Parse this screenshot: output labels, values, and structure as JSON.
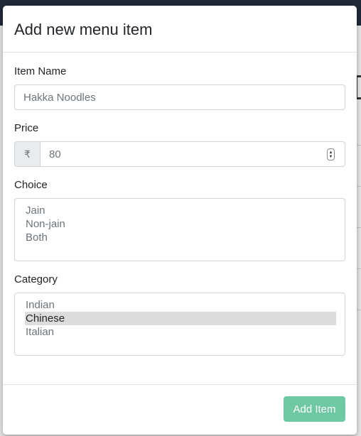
{
  "modal": {
    "title": "Add new menu item",
    "item_name": {
      "label": "Item Name",
      "placeholder": "Hakka Noodles"
    },
    "price": {
      "label": "Price",
      "currency_symbol": "₹",
      "placeholder": "80"
    },
    "choice": {
      "label": "Choice",
      "options": [
        "Jain",
        "Non-jain",
        "Both"
      ],
      "selected_index": -1
    },
    "category": {
      "label": "Category",
      "options": [
        "Indian",
        "Chinese",
        "Italian"
      ],
      "selected_index": 1
    },
    "submit_label": "Add Item"
  },
  "colors": {
    "primary_button": "#5fc49a",
    "backdrop": "#55595c",
    "top_bar": "#1e2a38"
  }
}
